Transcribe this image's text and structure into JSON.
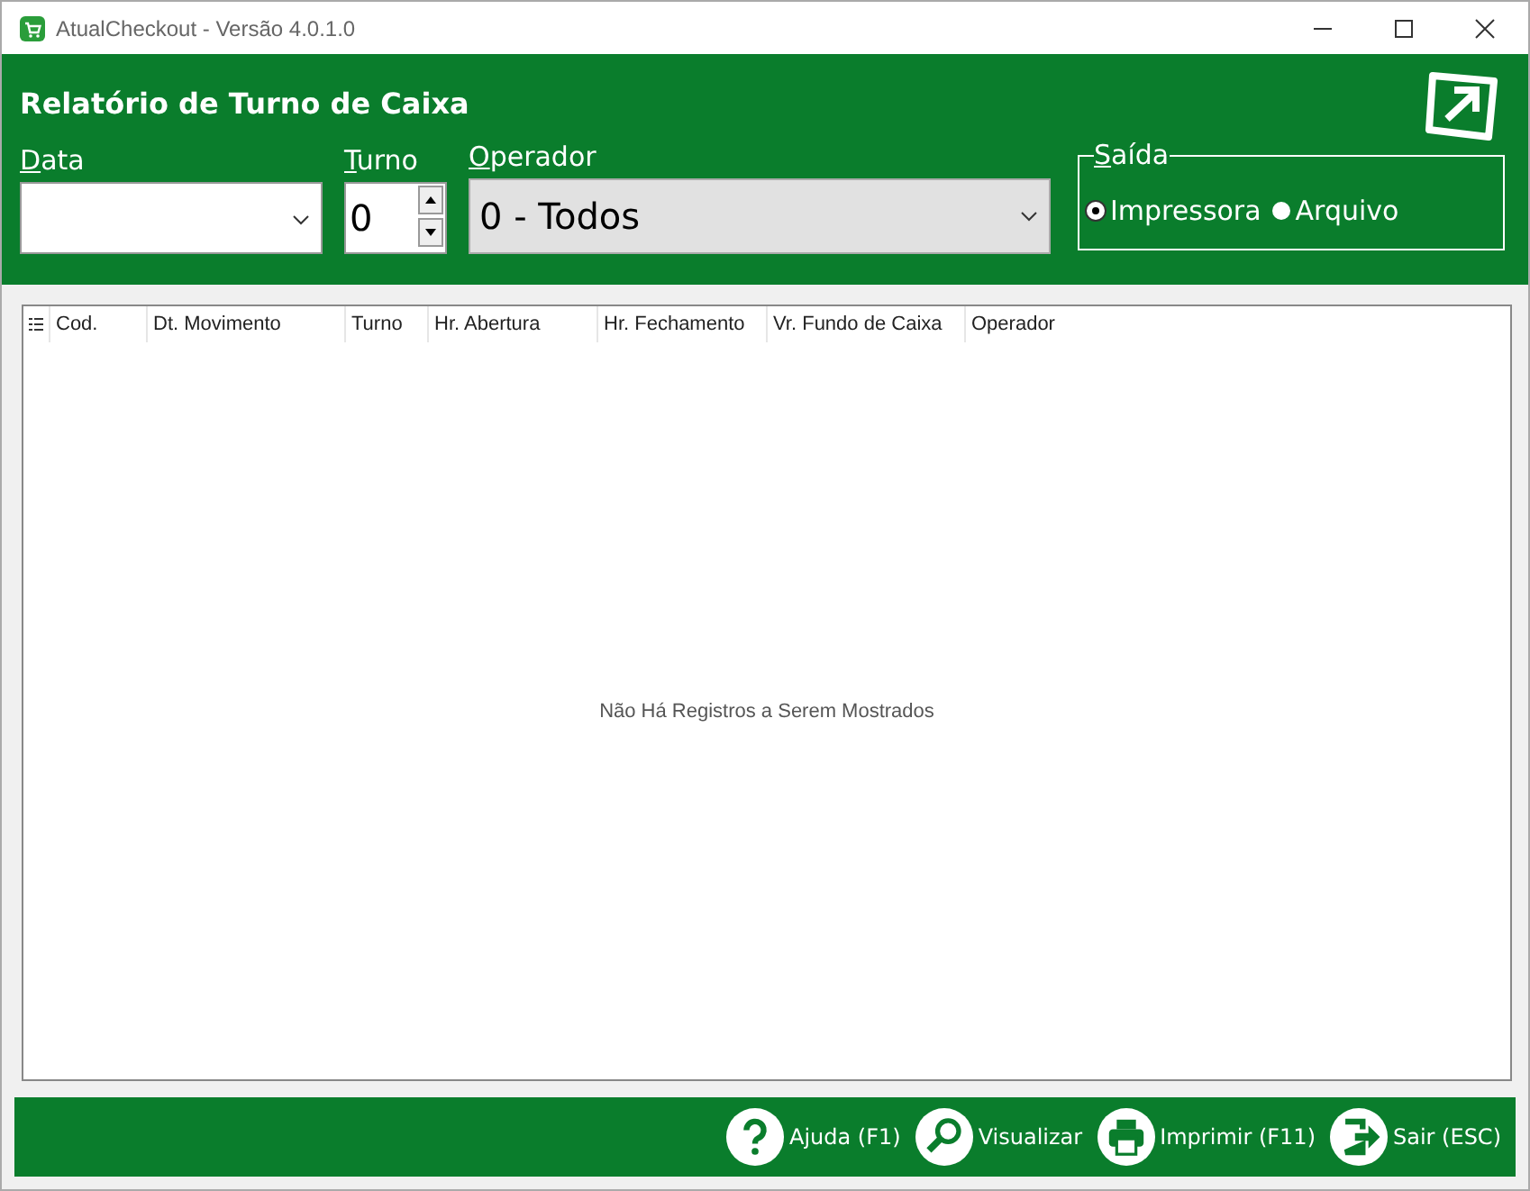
{
  "window": {
    "title": "AtualCheckout - Versão 4.0.1.0"
  },
  "header": {
    "title": "Relatório de Turno de Caixa"
  },
  "filters": {
    "date": {
      "label": "Data"
    },
    "shift": {
      "label": "Turno",
      "value": "0"
    },
    "operator": {
      "label": "Operador",
      "value": "0 - Todos"
    }
  },
  "output": {
    "label": "Saída",
    "options": [
      {
        "label": "Impressora",
        "selected": true
      },
      {
        "label": "Arquivo",
        "selected": false
      }
    ]
  },
  "table": {
    "columns": [
      "Cod.",
      "Dt. Movimento",
      "Turno",
      "Hr. Abertura",
      "Hr. Fechamento",
      "Vr. Fundo de Caixa",
      "Operador"
    ],
    "empty_message": "Não Há Registros a Serem Mostrados"
  },
  "buttons": [
    {
      "kind": "help",
      "label": "Ajuda (F1)"
    },
    {
      "kind": "search",
      "label": "Visualizar"
    },
    {
      "kind": "print",
      "label": "Imprimir (F11)"
    },
    {
      "kind": "exit",
      "label": "Sair (ESC)"
    }
  ]
}
